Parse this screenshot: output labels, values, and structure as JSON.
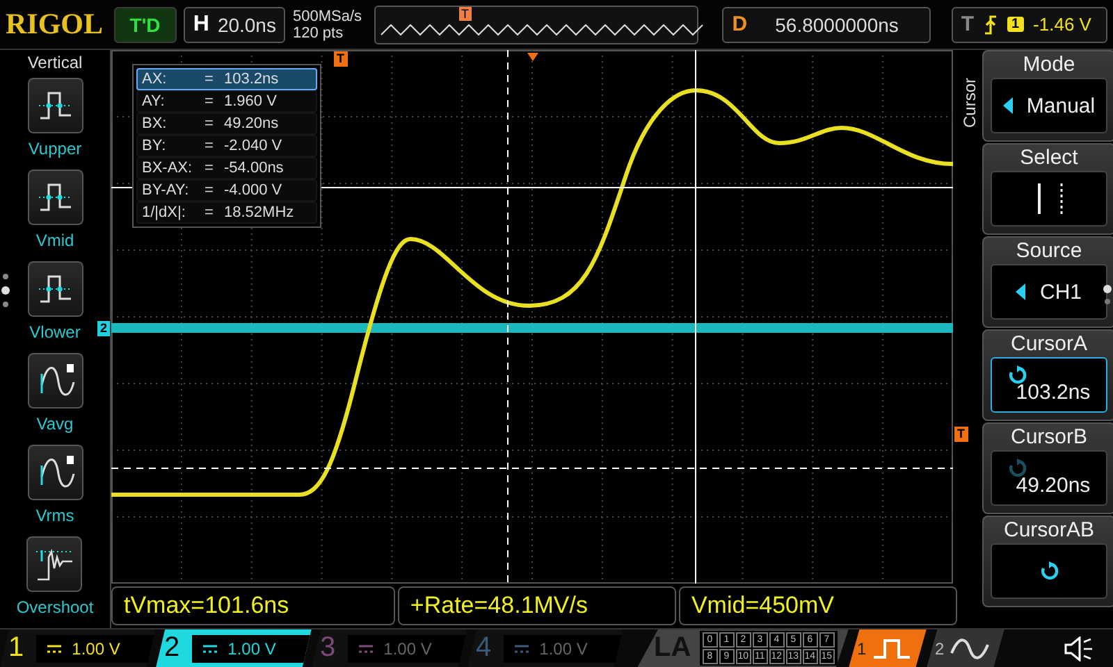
{
  "top_bar": {
    "logo": "RIGOL",
    "run_status": "T'D",
    "horizontal": {
      "label": "H",
      "timebase": "20.0ns"
    },
    "sample_rate": "500MSa/s",
    "memory_depth": "120 pts",
    "delay": {
      "label": "D",
      "value": "56.8000000ns"
    },
    "trigger": {
      "label": "T",
      "source": "1",
      "level": "-1.46 V"
    }
  },
  "sidebar": {
    "title": "Vertical",
    "items": [
      {
        "label": "Vupper",
        "kind": "pulse"
      },
      {
        "label": "Vmid",
        "kind": "pulse"
      },
      {
        "label": "Vlower",
        "kind": "pulse"
      },
      {
        "label": "Vavg",
        "kind": "sine"
      },
      {
        "label": "Vrms",
        "kind": "sine"
      },
      {
        "label": "Overshoot",
        "kind": "ringing"
      }
    ]
  },
  "cursor_readout": [
    {
      "label": "AX:",
      "eq": "=",
      "value": "103.2ns",
      "selected": true
    },
    {
      "label": "AY:",
      "eq": "=",
      "value": "1.960 V",
      "selected": false
    },
    {
      "label": "BX:",
      "eq": "=",
      "value": "49.20ns",
      "selected": false
    },
    {
      "label": "BY:",
      "eq": "=",
      "value": "-2.040 V",
      "selected": false
    },
    {
      "label": "BX-AX:",
      "eq": "=",
      "value": "-54.00ns",
      "selected": false
    },
    {
      "label": "BY-AY:",
      "eq": "=",
      "value": "-4.000 V",
      "selected": false
    },
    {
      "label": "1/|dX|:",
      "eq": "=",
      "value": "18.52MHz",
      "selected": false
    }
  ],
  "markers": {
    "channel": "2",
    "trigger_overview": "T",
    "trigger_top": "T",
    "trigger_right": "T"
  },
  "menu": {
    "title": "Cursor",
    "items": [
      {
        "label": "Mode",
        "kind": "choice",
        "value": "Manual",
        "active": false
      },
      {
        "label": "Select",
        "kind": "select",
        "active": false
      },
      {
        "label": "Source",
        "kind": "choice",
        "value": "CH1",
        "active": false
      },
      {
        "label": "CursorA",
        "kind": "knob",
        "value": "103.2ns",
        "active": true,
        "knob_enabled": true
      },
      {
        "label": "CursorB",
        "kind": "knob",
        "value": "49.20ns",
        "active": false,
        "knob_enabled": false
      },
      {
        "label": "CursorAB",
        "kind": "knob",
        "active": false,
        "knob_enabled": true
      }
    ]
  },
  "measurements": [
    "tVmax=101.6ns",
    "+Rate=48.1MV/s",
    "Vmid=450mV"
  ],
  "channels": [
    {
      "number": "1",
      "scale": "1.00 V",
      "on": true,
      "selected": false,
      "color": "#f0e020"
    },
    {
      "number": "2",
      "scale": "1.00 V",
      "on": true,
      "selected": true,
      "color": "#20d8e0"
    },
    {
      "number": "3",
      "scale": "1.00 V",
      "on": false,
      "selected": false,
      "color": "#7a4a7a"
    },
    {
      "number": "4",
      "scale": "1.00 V",
      "on": false,
      "selected": false,
      "color": "#3a5a7a"
    }
  ],
  "logic_analyzer": {
    "label": "LA",
    "bits": [
      "0",
      "1",
      "2",
      "3",
      "4",
      "5",
      "6",
      "7",
      "8",
      "9",
      "10",
      "11",
      "12",
      "13",
      "14",
      "15"
    ]
  },
  "sources": [
    {
      "number": "1",
      "kind": "pulse",
      "selected": true
    },
    {
      "number": "2",
      "kind": "sine",
      "selected": false
    }
  ]
}
